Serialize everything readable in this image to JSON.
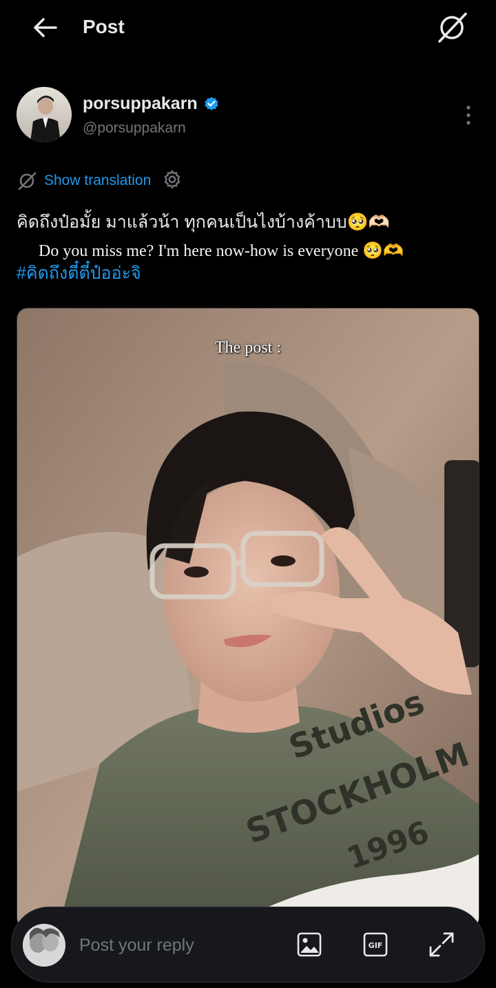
{
  "header": {
    "title": "Post",
    "back_icon": "arrow-left-icon",
    "grok_icon": "grok-icon"
  },
  "author": {
    "display_name": "porsuppakarn",
    "handle": "@porsuppakarn",
    "verified": true,
    "verified_color": "#1d9bf0"
  },
  "translation": {
    "label": "Show translation"
  },
  "post": {
    "text": "คิดถึงป๋อมั้ย มาแล้วน้า ทุกคนเป็นไงบ้างค้าบบ🥺🫶🏻",
    "hashtag": "#คิดถึงตี๋ตี๋ป๋ออ่ะจิ",
    "overlay_subtitle": "Do you miss me? I'm here now-how is everyone 🥺🫶",
    "image_caption": "The post :",
    "image_shirt_text": [
      "Studios",
      "STOCKHOLM",
      "1996"
    ]
  },
  "reply": {
    "placeholder": "Post your reply",
    "gif_label": "GIF"
  },
  "colors": {
    "background": "#000000",
    "accent": "#1d9bf0",
    "muted": "#71767b"
  }
}
